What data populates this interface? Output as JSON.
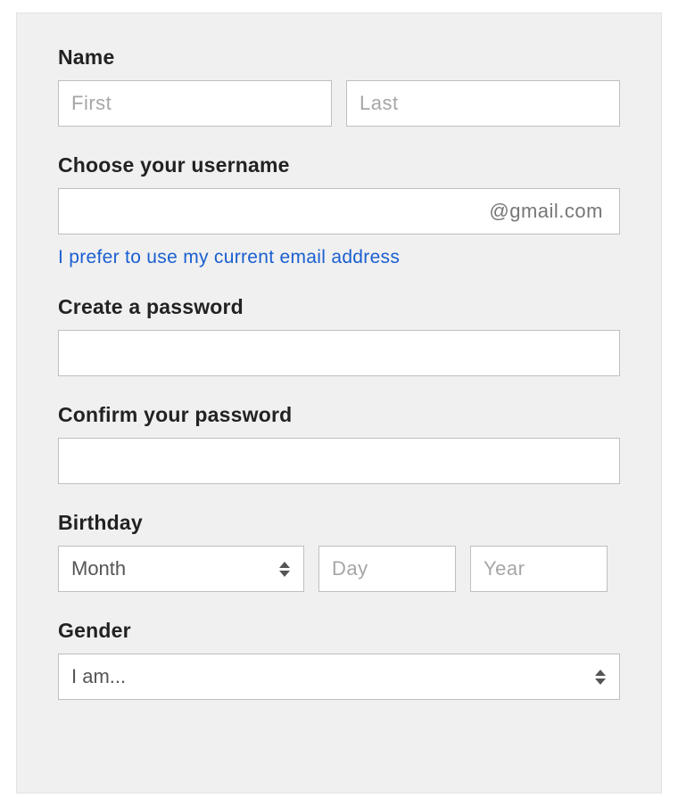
{
  "name": {
    "label": "Name",
    "first_placeholder": "First",
    "last_placeholder": "Last"
  },
  "username": {
    "label": "Choose your username",
    "suffix": "@gmail.com",
    "alt_link": "I prefer to use my current email address"
  },
  "password": {
    "create_label": "Create a password",
    "confirm_label": "Confirm your password"
  },
  "birthday": {
    "label": "Birthday",
    "month_placeholder": "Month",
    "day_placeholder": "Day",
    "year_placeholder": "Year"
  },
  "gender": {
    "label": "Gender",
    "placeholder": "I am..."
  }
}
